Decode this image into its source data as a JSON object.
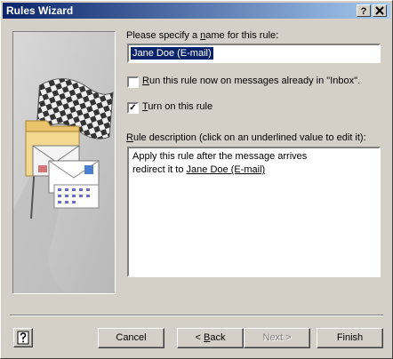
{
  "window": {
    "title": "Rules Wizard",
    "help_button": "?",
    "close_button": "X"
  },
  "name_label": {
    "before": "Please specify a ",
    "mnemonic": "n",
    "after": "ame for this rule:"
  },
  "rule_name_value": "Jane Doe (E-mail)",
  "run_now": {
    "mnemonic": "R",
    "rest": "un this rule now on messages already in \"Inbox\".",
    "checked": false
  },
  "turn_on": {
    "mnemonic": "T",
    "rest": "urn on this rule",
    "checked": true,
    "check_glyph": "✓"
  },
  "description_label": {
    "mnemonic": "R",
    "rest": "ule description (click on an underlined value to edit it):"
  },
  "description": {
    "line1": "Apply this rule after the message arrives",
    "line2_prefix": "redirect it to ",
    "line2_link": "Jane Doe (E-mail)"
  },
  "buttons": {
    "cancel": "Cancel",
    "back_arrow": "< ",
    "back_mnemonic": "B",
    "back_rest": "ack",
    "next": "Next >",
    "finish": "Finish"
  },
  "icons": {
    "help_icon": "question-mark-icon"
  }
}
